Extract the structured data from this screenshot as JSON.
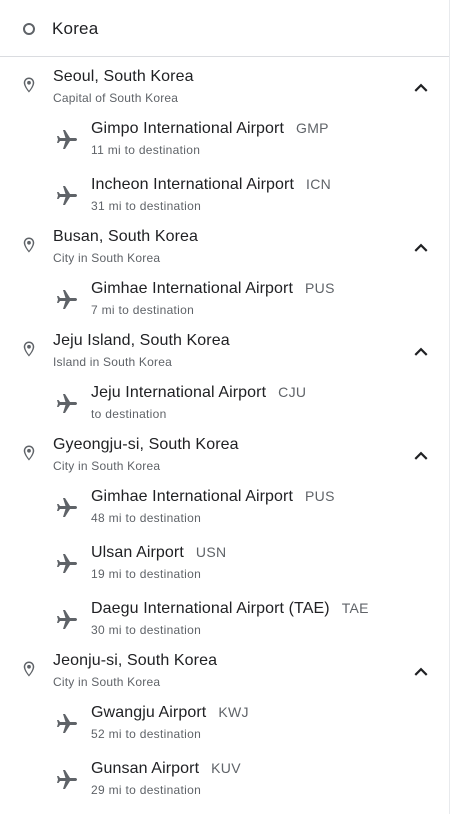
{
  "search": {
    "value": "Korea"
  },
  "cities": [
    {
      "name": "Seoul, South Korea",
      "description": "Capital of South Korea",
      "airports": [
        {
          "name": "Gimpo International Airport",
          "code": "GMP",
          "distance": "11 mi to destination"
        },
        {
          "name": "Incheon International Airport",
          "code": "ICN",
          "distance": "31 mi to destination"
        }
      ]
    },
    {
      "name": "Busan, South Korea",
      "description": "City in South Korea",
      "airports": [
        {
          "name": "Gimhae International Airport",
          "code": "PUS",
          "distance": "7 mi to destination"
        }
      ]
    },
    {
      "name": "Jeju Island, South Korea",
      "description": "Island in South Korea",
      "airports": [
        {
          "name": "Jeju International Airport",
          "code": "CJU",
          "distance": "to destination"
        }
      ]
    },
    {
      "name": "Gyeongju-si, South Korea",
      "description": "City in South Korea",
      "airports": [
        {
          "name": "Gimhae International Airport",
          "code": "PUS",
          "distance": "48 mi to destination"
        },
        {
          "name": "Ulsan Airport",
          "code": "USN",
          "distance": "19 mi to destination"
        },
        {
          "name": "Daegu International Airport (TAE)",
          "code": "TAE",
          "distance": "30 mi to destination"
        }
      ]
    },
    {
      "name": "Jeonju-si, South Korea",
      "description": "City in South Korea",
      "airports": [
        {
          "name": "Gwangju Airport",
          "code": "KWJ",
          "distance": "52 mi to destination"
        },
        {
          "name": "Gunsan Airport",
          "code": "KUV",
          "distance": "29 mi to destination"
        }
      ]
    }
  ],
  "icons": {
    "origin": "origin-circle-icon",
    "city": "location-pin-icon",
    "airport": "airplane-icon",
    "collapse": "chevron-up-icon"
  },
  "colors": {
    "text": "#202124",
    "secondary": "#5f6368",
    "divider": "#dadce0"
  }
}
